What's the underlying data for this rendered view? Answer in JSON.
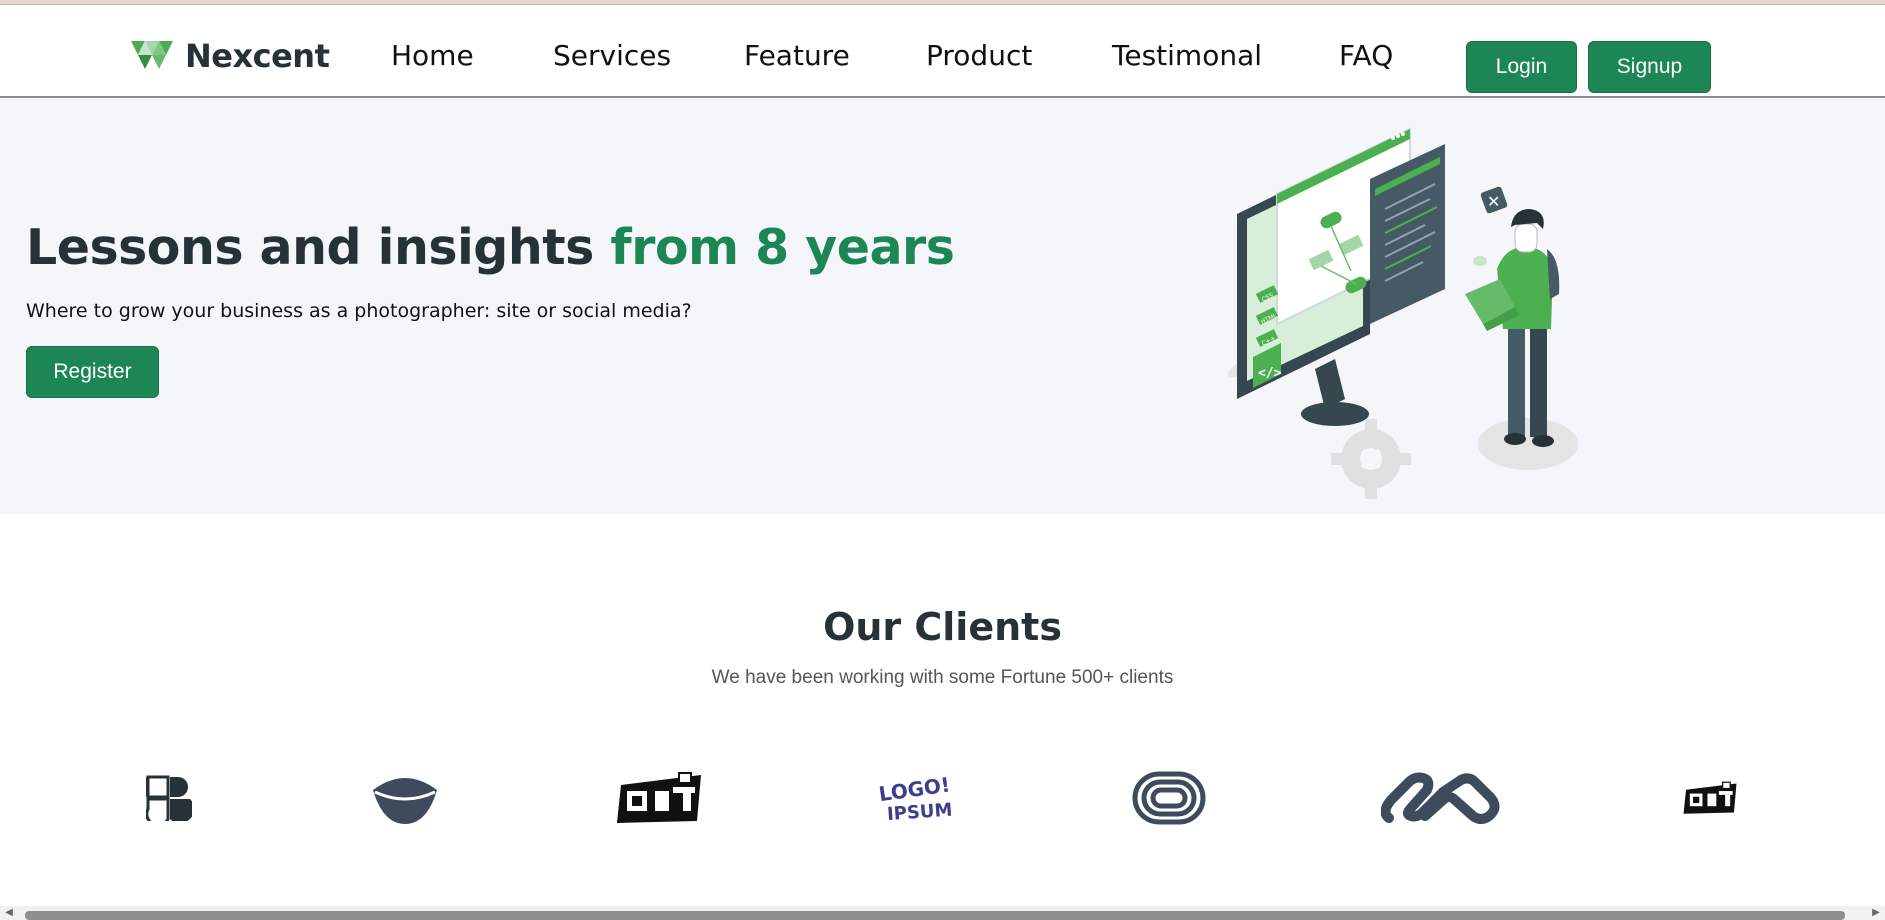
{
  "navbar": {
    "brand": "Nexcent",
    "links": [
      "Home",
      "Services",
      "Feature",
      "Product",
      "Testimonal",
      "FAQ"
    ],
    "login_label": "Login",
    "signup_label": "Signup"
  },
  "hero": {
    "title_main": "Lessons and insights ",
    "title_accent": "from 8 years",
    "subtitle": "Where to grow your business as a photographer: site or social media?",
    "register_label": "Register",
    "illustration_tags": [
      "CSS",
      "HTML",
      "C++"
    ]
  },
  "clients": {
    "title": "Our Clients",
    "subtitle": "We have been working with some Fortune 500+ clients",
    "logos": [
      "client-logo-1",
      "client-logo-2",
      "client-logo-3",
      "client-logo-4",
      "client-logo-5",
      "client-logo-6",
      "client-logo-7"
    ],
    "logo4_text": [
      "LOGO!",
      "IPSUM"
    ]
  },
  "colors": {
    "brand_green": "#1c8754",
    "dark_text": "#263238",
    "hero_bg": "#f4f6f9"
  }
}
